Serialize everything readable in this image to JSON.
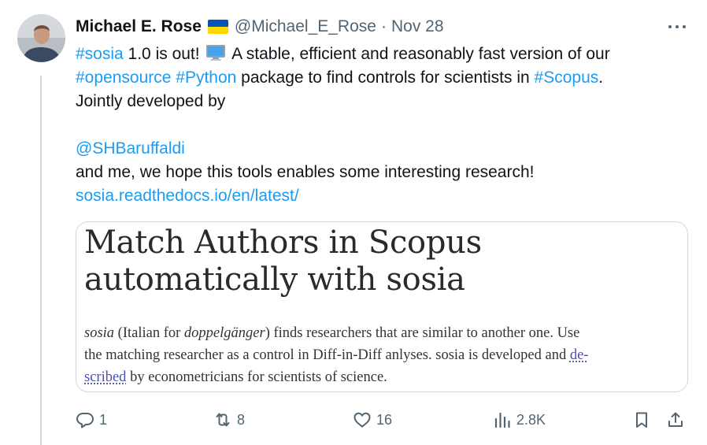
{
  "author": {
    "name": "Michael E. Rose",
    "handle": "@Michael_E_Rose",
    "separator": "·",
    "date": "Nov 28"
  },
  "tweet": {
    "hashtag_sosia": "#sosia",
    "text_1a": " 1.0 is out! ",
    "text_1b": " A stable, efficient and reasonably fast version of our",
    "hashtag_opensource": "#opensource",
    "hashtag_python": "#Python",
    "text_2": " package to find controls for scientists in ",
    "hashtag_scopus": "#Scopus",
    "text_2_end": ".",
    "text_3": "Jointly developed by",
    "mention": "@SHBaruffaldi",
    "text_5": "and me, we hope this tools enables some interesting research!",
    "url": "sosia.readthedocs.io/en/latest/"
  },
  "card": {
    "title_line1": "Match Authors in Scopus",
    "title_line2": "automatically with sosia",
    "desc_sosia": "sosia",
    "desc_1a": " (Italian for ",
    "desc_doppel": "doppelgänger",
    "desc_1b": ") finds researchers that are similar to another one. Use",
    "desc_2a": "the matching researcher as a control in Diff-in-Diff anlyses. sosia is developed and ",
    "desc_link1": "de-",
    "desc_link2": "scribed",
    "desc_3": " by econometricians for scientists of science."
  },
  "actions": {
    "replies": "1",
    "reposts": "8",
    "likes": "16",
    "views": "2.8K"
  },
  "colors": {
    "link": "#1d9bf0",
    "secondary": "#536471",
    "flag_blue": "#0057b7",
    "flag_yellow": "#ffd700"
  },
  "icons": [
    "computer-emoji-icon",
    "ukraine-flag-icon",
    "more-icon",
    "reply-icon",
    "repost-icon",
    "like-icon",
    "views-icon",
    "bookmark-icon",
    "share-icon"
  ]
}
